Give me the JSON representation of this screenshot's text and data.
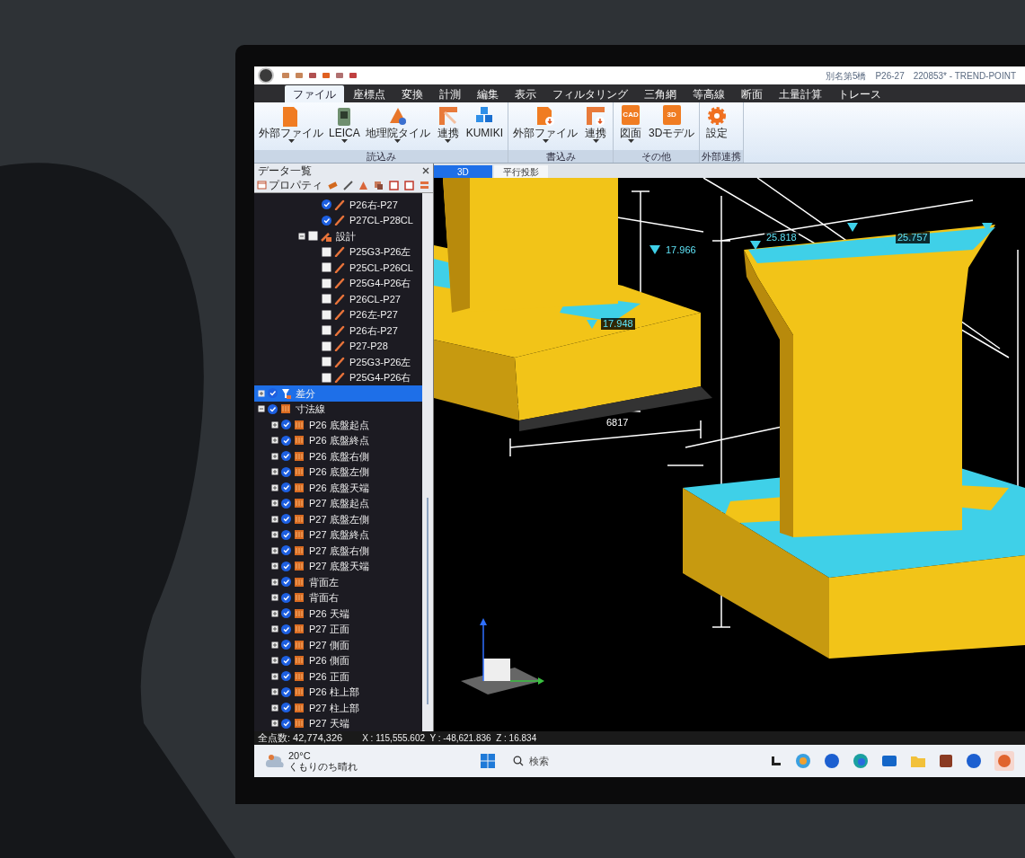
{
  "window": {
    "title": "別名第5橋　P26-27　220853* - TREND-POINT"
  },
  "menu_tabs": [
    {
      "label": "ファイル",
      "selected": true
    },
    {
      "label": "座標点",
      "selected": false
    },
    {
      "label": "変換",
      "selected": false
    },
    {
      "label": "計測",
      "selected": false
    },
    {
      "label": "編集",
      "selected": false
    },
    {
      "label": "表示",
      "selected": false
    },
    {
      "label": "フィルタリング",
      "selected": false
    },
    {
      "label": "三角網",
      "selected": false
    },
    {
      "label": "等高線",
      "selected": false
    },
    {
      "label": "断面",
      "selected": false
    },
    {
      "label": "土量計算",
      "selected": false
    },
    {
      "label": "トレース",
      "selected": false
    }
  ],
  "ribbon_groups": [
    {
      "label": "読込み",
      "buttons": [
        {
          "label": "外部ファイル",
          "kind": "file",
          "dropdown": true
        },
        {
          "label": "LEICA",
          "kind": "scanner",
          "dropdown": true
        },
        {
          "label": "地理院タイル",
          "kind": "tile",
          "dropdown": true
        },
        {
          "label": "連携",
          "kind": "link",
          "dropdown": true
        },
        {
          "label": "KUMIKI",
          "kind": "blocks",
          "dropdown": false
        }
      ]
    },
    {
      "label": "書込み",
      "buttons": [
        {
          "label": "外部ファイル",
          "kind": "file-down",
          "dropdown": true
        },
        {
          "label": "連携",
          "kind": "link-down",
          "dropdown": true
        }
      ]
    },
    {
      "label": "その他",
      "buttons": [
        {
          "label": "図面",
          "kind": "badge",
          "icon_text": "CAD",
          "dropdown": true
        },
        {
          "label": "3Dモデル",
          "kind": "badge",
          "icon_text": "3D",
          "dropdown": false
        }
      ]
    },
    {
      "label": "外部連携",
      "buttons": [
        {
          "label": "設定",
          "kind": "gear",
          "dropdown": false
        }
      ]
    }
  ],
  "data_panel": {
    "title": "データ一覧",
    "toolbar_label": "プロパティ",
    "continued_items": [
      {
        "label": "P26右-P27",
        "kind": "line",
        "checked": true
      },
      {
        "label": "P27CL-P28CL",
        "kind": "line",
        "checked": true
      }
    ],
    "continued_siblings": [
      {
        "label": "設計",
        "kind": "group",
        "checked": false,
        "expanded": true,
        "children": [
          {
            "label": "P25G3-P26左",
            "kind": "line",
            "checked": false
          },
          {
            "label": "P25CL-P26CL",
            "kind": "line",
            "checked": false
          },
          {
            "label": "P25G4-P26右",
            "kind": "line",
            "checked": false
          },
          {
            "label": "P26CL-P27",
            "kind": "line",
            "checked": false
          },
          {
            "label": "P26左-P27",
            "kind": "line",
            "checked": false
          },
          {
            "label": "P26右-P27",
            "kind": "line",
            "checked": false
          },
          {
            "label": "P27-P28",
            "kind": "line",
            "checked": false
          },
          {
            "label": "P25G3-P26左",
            "kind": "line",
            "checked": false
          },
          {
            "label": "P25G4-P26右",
            "kind": "line",
            "checked": false
          }
        ]
      }
    ],
    "tree": [
      {
        "label": "差分",
        "kind": "diff",
        "checked": true,
        "expanded": false,
        "selected": true
      },
      {
        "label": "寸法線",
        "kind": "dimension",
        "checked": true,
        "expanded": true,
        "selected": false,
        "children": [
          {
            "label": "P26 底盤起点",
            "kind": "dimension",
            "checked": true,
            "expanded": false
          },
          {
            "label": "P26 底盤終点",
            "kind": "dimension",
            "checked": true,
            "expanded": false
          },
          {
            "label": "P26 底盤右側",
            "kind": "dimension",
            "checked": true,
            "expanded": false
          },
          {
            "label": "P26 底盤左側",
            "kind": "dimension",
            "checked": true,
            "expanded": false
          },
          {
            "label": "P26 底盤天端",
            "kind": "dimension",
            "checked": true,
            "expanded": false
          },
          {
            "label": "P27 底盤起点",
            "kind": "dimension",
            "checked": true,
            "expanded": false
          },
          {
            "label": "P27 底盤左側",
            "kind": "dimension",
            "checked": true,
            "expanded": false
          },
          {
            "label": "P27 底盤終点",
            "kind": "dimension",
            "checked": true,
            "expanded": false
          },
          {
            "label": "P27 底盤右側",
            "kind": "dimension",
            "checked": true,
            "expanded": false
          },
          {
            "label": "P27 底盤天端",
            "kind": "dimension",
            "checked": true,
            "expanded": false
          },
          {
            "label": "背面左",
            "kind": "dimension",
            "checked": true,
            "expanded": false
          },
          {
            "label": "背面右",
            "kind": "dimension",
            "checked": true,
            "expanded": false
          },
          {
            "label": "P26 天端",
            "kind": "dimension",
            "checked": true,
            "expanded": false
          },
          {
            "label": "P27 正面",
            "kind": "dimension",
            "checked": true,
            "expanded": false
          },
          {
            "label": "P27 側面",
            "kind": "dimension",
            "checked": true,
            "expanded": false
          },
          {
            "label": "P26 側面",
            "kind": "dimension",
            "checked": true,
            "expanded": false
          },
          {
            "label": "P26 正面",
            "kind": "dimension",
            "checked": true,
            "expanded": false
          },
          {
            "label": "P26 柱上部",
            "kind": "dimension",
            "checked": true,
            "expanded": false
          },
          {
            "label": "P27 柱上部",
            "kind": "dimension",
            "checked": true,
            "expanded": false
          },
          {
            "label": "P27 天端",
            "kind": "dimension",
            "checked": true,
            "expanded": false
          }
        ]
      }
    ]
  },
  "view_tabs": [
    {
      "label": "3D",
      "selected": true
    },
    {
      "label": "平行投影",
      "selected": false
    }
  ],
  "viewport": {
    "labels": [
      "17.966",
      "17.948",
      "6817",
      "25.818",
      "25.757"
    ]
  },
  "status_bar": {
    "point_count": "全点数: 42,774,326",
    "coordinates": "X : 115,555.602  Y : -48,621.836  Z : 16.834"
  },
  "taskbar": {
    "temperature": "20°C",
    "weather": "くもりのち晴れ",
    "search": "検索"
  }
}
